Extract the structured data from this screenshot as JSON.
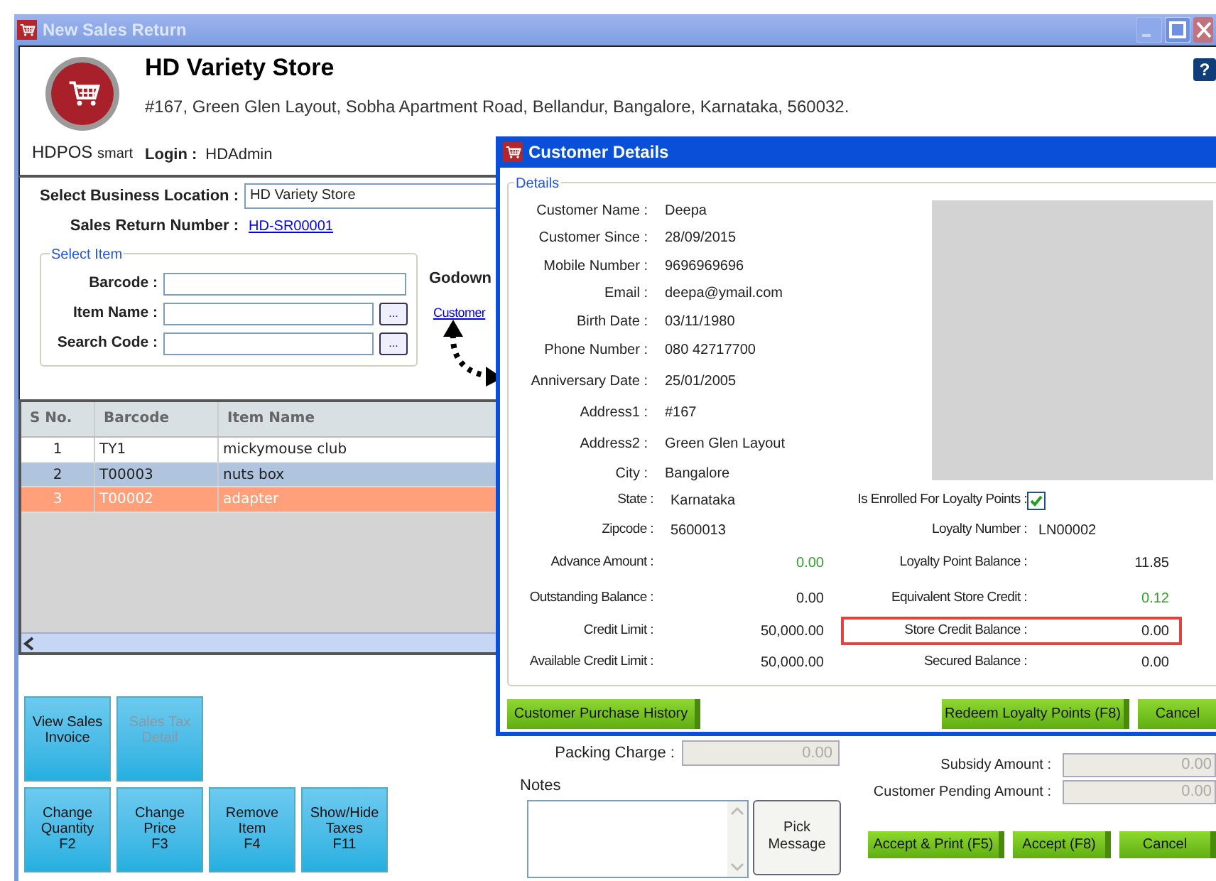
{
  "window": {
    "title": "New Sales Return"
  },
  "header": {
    "logo_text": "HDPOS",
    "logo_suffix": "smart",
    "store_name": "HD Variety Store",
    "address": "#167, Green Glen Layout, Sobha Apartment Road, Bellandur, Bangalore, Karnataka, 560032.",
    "login_label": "Login :",
    "login_value": "HDAdmin",
    "help_label": "?"
  },
  "form": {
    "location_label": "Select Business Location :",
    "location_value": "HD Variety Store",
    "return_number_label": "Sales Return Number :",
    "return_number": "HD-SR00001",
    "select_item": {
      "title": "Select Item",
      "fields": [
        {
          "label": "Barcode :",
          "lookup": false
        },
        {
          "label": "Item Name :",
          "lookup": true
        },
        {
          "label": "Search Code :",
          "lookup": true
        }
      ],
      "lookup_label": "..."
    },
    "godown_label": "Godown",
    "customer_link": "Customer"
  },
  "table": {
    "columns": [
      "S No.",
      "Barcode",
      "Item Name"
    ],
    "rows": [
      {
        "cells": [
          "1",
          "TY1",
          "mickymouse club"
        ],
        "selected": false,
        "current": false
      },
      {
        "cells": [
          "2",
          "T00003",
          "nuts box"
        ],
        "selected": true,
        "current": false
      },
      {
        "cells": [
          "3",
          "T00002",
          "adapter"
        ],
        "selected": false,
        "current": true
      }
    ]
  },
  "action_buttons": [
    [
      {
        "label": "View Sales\nInvoice",
        "disabled": false
      },
      {
        "label": "Sales Tax\nDetail",
        "disabled": true
      }
    ],
    [
      {
        "label": "Change\nQuantity\nF2",
        "disabled": false
      },
      {
        "label": "Change\nPrice\nF3",
        "disabled": false
      },
      {
        "label": "Remove\nItem\nF4",
        "disabled": false
      },
      {
        "label": "Show/Hide\nTaxes\nF11",
        "disabled": false
      }
    ]
  ],
  "packing": {
    "label": "Packing Charge :",
    "value": "0.00"
  },
  "notes": {
    "label": "Notes",
    "pick_button": "Pick\nMessage"
  },
  "amounts": [
    {
      "label": "Subsidy Amount :",
      "value": "0.00"
    },
    {
      "label": "Customer Pending Amount :",
      "value": "0.00"
    }
  ],
  "footer_buttons": [
    "Accept & Print (F5)",
    "Accept (F8)",
    "Cancel"
  ],
  "dialog": {
    "title": "Customer Details",
    "group_label": "Details",
    "fields": [
      {
        "label": "Customer Name :",
        "value": "Deepa"
      },
      {
        "label": "Customer Since :",
        "value": "28/09/2015"
      },
      {
        "label": "Mobile Number :",
        "value": "9696969696"
      },
      {
        "label": "Email :",
        "value": "deepa@ymail.com"
      },
      {
        "label": "Birth Date :",
        "value": "03/11/1980"
      },
      {
        "label": "Phone Number :",
        "value": "080 42717700"
      },
      {
        "label": "Anniversary Date :",
        "value": "25/01/2005"
      },
      {
        "label": "Address1 :",
        "value": "#167"
      },
      {
        "label": "Address2 :",
        "value": "Green Glen Layout"
      },
      {
        "label": "City :",
        "value": "Bangalore"
      }
    ],
    "rows": [
      {
        "left": {
          "kind": "text",
          "label": "State :",
          "value": "Karnataka"
        },
        "right": {
          "kind": "checkbox",
          "label": "Is Enrolled For Loyalty Points :",
          "checked": true
        }
      },
      {
        "left": {
          "kind": "text",
          "label": "Zipcode :",
          "value": "5600013"
        },
        "right": {
          "kind": "text",
          "label": "Loyalty Number :",
          "value": "LN00002"
        }
      },
      {
        "left": {
          "kind": "amount",
          "label": "Advance Amount :",
          "value": "0.00",
          "color": "#33a02c"
        },
        "right": {
          "kind": "amount",
          "label": "Loyalty Point Balance :",
          "value": "11.85",
          "color": "#222222"
        }
      },
      {
        "left": {
          "kind": "amount",
          "label": "Outstanding Balance :",
          "value": "0.00",
          "color": "#222222"
        },
        "right": {
          "kind": "amount",
          "label": "Equivalent Store Credit :",
          "value": "0.12",
          "color": "#33a02c"
        }
      },
      {
        "left": {
          "kind": "amount",
          "label": "Credit Limit :",
          "value": "50,000.00",
          "color": "#222222"
        },
        "right": {
          "kind": "amount",
          "label": "Store Credit Balance :",
          "value": "0.00",
          "color": "#222222",
          "outlined": true
        }
      },
      {
        "left": {
          "kind": "amount",
          "label": "Available Credit Limit :",
          "value": "50,000.00",
          "color": "#222222"
        },
        "right": {
          "kind": "amount",
          "label": "Secured Balance :",
          "value": "0.00",
          "color": "#222222",
          "outlined": false
        }
      }
    ],
    "buttons": [
      {
        "label": "Customer Purchase History"
      },
      {
        "label": "Redeem Loyalty Points (F8)"
      },
      {
        "label": "Cancel"
      }
    ]
  }
}
